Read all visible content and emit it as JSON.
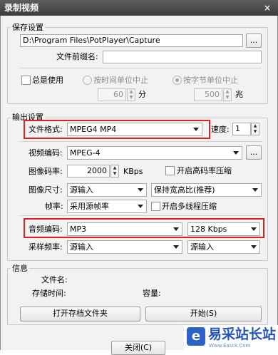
{
  "window": {
    "title": "录制视频",
    "close_glyph": "×"
  },
  "save": {
    "group_label": "保存设置",
    "path_value": "D:\\Program Files\\PotPlayer\\Capture",
    "browse_label": "...",
    "prefix_label": "文件前缀名:",
    "prefix_value": "",
    "always_use_label": "总是使用",
    "by_time_label": "按时间单位中止",
    "time_value": "60",
    "time_unit": "分",
    "by_size_label": "按字节单位中止",
    "size_value": "500",
    "size_unit": "兆"
  },
  "output": {
    "group_label": "输出设置",
    "format_label": "文件格式:",
    "format_value": "MPEG4 MP4",
    "speed_label": "速度:",
    "speed_value": "1",
    "video_codec_label": "视频编码:",
    "video_codec_value": "MPEG-4",
    "video_browse_label": "...",
    "bitrate_label": "图像码率:",
    "bitrate_value": "2000",
    "bitrate_unit": "KBps",
    "high_bitrate_label": "开启高码率压缩",
    "size_label": "图像尺寸:",
    "size_value": "源输入",
    "aspect_value": "保持宽高比(推荐)",
    "framerate_label": "帧率:",
    "framerate_value": "采用源帧率",
    "multithread_label": "开启多线程压缩",
    "audio_codec_label": "音频编码:",
    "audio_codec_value": "MP3",
    "audio_bitrate_value": "128 Kbps",
    "samplerate_label": "采样频率:",
    "samplerate_value": "源输入",
    "channels_value": "源输入"
  },
  "info": {
    "group_label": "信息",
    "filename_label": "文件名:",
    "storetime_label": "存储时间:",
    "capacity_label": "容量:"
  },
  "actions": {
    "open_folder_label": "打开存档文件夹",
    "start_label": "开始(S)",
    "close_label": "关闭(C)"
  },
  "watermark": {
    "logo_glyph": "e",
    "name": "易采站长站",
    "url": "Www.Easck.Com"
  },
  "colors": {
    "highlight_box": "#e02020",
    "titlebar": "#4a4a4a",
    "watermark_blue": "#2355b8"
  }
}
